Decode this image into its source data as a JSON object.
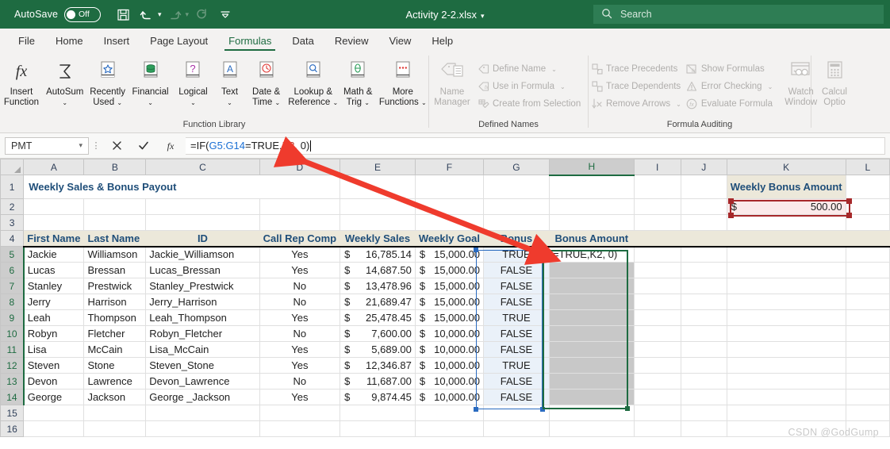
{
  "titlebar": {
    "autosave_label": "AutoSave",
    "autosave_state": "Off",
    "save_icon": "save-icon",
    "undo_icon": "undo-icon",
    "redo_icon": "redo-icon",
    "refresh_icon": "refresh-icon",
    "customize_icon": "customize-quick-access-icon",
    "document_title": "Activity 2-2.xlsx",
    "search_placeholder": "Search",
    "search_icon": "search-icon",
    "accent_color": "#1e6b41"
  },
  "tabs": [
    {
      "label": "File",
      "active": false
    },
    {
      "label": "Home",
      "active": false
    },
    {
      "label": "Insert",
      "active": false
    },
    {
      "label": "Page Layout",
      "active": false
    },
    {
      "label": "Formulas",
      "active": true
    },
    {
      "label": "Data",
      "active": false
    },
    {
      "label": "Review",
      "active": false
    },
    {
      "label": "View",
      "active": false
    },
    {
      "label": "Help",
      "active": false
    }
  ],
  "ribbon": {
    "groups": [
      {
        "title": "Function Library",
        "buttons": [
          {
            "label_line1": "Insert",
            "label_line2": "Function",
            "icon": "insert-function-icon",
            "caret": false
          },
          {
            "label_line1": "AutoSum",
            "label_line2": "",
            "icon": "autosum-icon",
            "caret": true
          },
          {
            "label_line1": "Recently",
            "label_line2": "Used",
            "icon": "recently-used-icon",
            "caret": true
          },
          {
            "label_line1": "Financial",
            "label_line2": "",
            "icon": "financial-icon",
            "caret": true
          },
          {
            "label_line1": "Logical",
            "label_line2": "",
            "icon": "logical-icon",
            "caret": true
          },
          {
            "label_line1": "Text",
            "label_line2": "",
            "icon": "text-icon",
            "caret": true
          },
          {
            "label_line1": "Date &",
            "label_line2": "Time",
            "icon": "date-time-icon",
            "caret": true
          },
          {
            "label_line1": "Lookup &",
            "label_line2": "Reference",
            "icon": "lookup-reference-icon",
            "caret": true
          },
          {
            "label_line1": "Math &",
            "label_line2": "Trig",
            "icon": "math-trig-icon",
            "caret": true
          },
          {
            "label_line1": "More",
            "label_line2": "Functions",
            "icon": "more-functions-icon",
            "caret": true
          }
        ]
      },
      {
        "title": "Defined Names",
        "big": {
          "label_line1": "Name",
          "label_line2": "Manager",
          "icon": "name-manager-icon"
        },
        "items": [
          {
            "label": "Define Name",
            "icon": "define-name-icon",
            "caret": true
          },
          {
            "label": "Use in Formula",
            "icon": "use-in-formula-icon",
            "caret": true
          },
          {
            "label": "Create from Selection",
            "icon": "create-from-selection-icon",
            "caret": false
          }
        ]
      },
      {
        "title": "Formula Auditing",
        "col1": [
          {
            "label": "Trace Precedents",
            "icon": "trace-precedents-icon",
            "caret": false
          },
          {
            "label": "Trace Dependents",
            "icon": "trace-dependents-icon",
            "caret": false
          },
          {
            "label": "Remove Arrows",
            "icon": "remove-arrows-icon",
            "caret": true
          }
        ],
        "col2": [
          {
            "label": "Show Formulas",
            "icon": "show-formulas-icon",
            "caret": false
          },
          {
            "label": "Error Checking",
            "icon": "error-checking-icon",
            "caret": true
          },
          {
            "label": "Evaluate Formula",
            "icon": "evaluate-formula-icon",
            "caret": false
          }
        ],
        "watch": {
          "label_line1": "Watch",
          "label_line2": "Window",
          "icon": "watch-window-icon"
        }
      },
      {
        "title": "",
        "calc": {
          "label_line1": "Calcul",
          "label_line2": "Optio",
          "icon": "calculation-options-icon"
        }
      }
    ]
  },
  "formula_bar": {
    "name_box_value": "PMT",
    "cancel_icon": "cancel-icon",
    "enter_icon": "confirm-icon",
    "insert_function_icon": "insert-function-icon",
    "formula_parts": [
      {
        "text": "=IF(",
        "color": "#000000"
      },
      {
        "text": "G5:G14",
        "color": "#1a6fd4"
      },
      {
        "text": "=TRUE,",
        "color": "#000000"
      },
      {
        "text": "K2",
        "color": "#c0392b"
      },
      {
        "text": ", 0)",
        "color": "#000000"
      }
    ],
    "formula_full": "=IF(G5:G14=TRUE,K2, 0)"
  },
  "sheet": {
    "column_headers": [
      "A",
      "B",
      "C",
      "D",
      "E",
      "F",
      "G",
      "H",
      "I",
      "J",
      "K",
      "L"
    ],
    "selected_column": "H",
    "row_numbers": [
      "1",
      "2",
      "3",
      "4",
      "5",
      "6",
      "7",
      "8",
      "9",
      "10",
      "11",
      "12",
      "13",
      "14",
      "15",
      "16"
    ],
    "selected_rows": [
      "5",
      "6",
      "7",
      "8",
      "9",
      "10",
      "11",
      "12",
      "13",
      "14"
    ],
    "title_cell": "Weekly Sales & Bonus Payout",
    "k_banner": "Weekly Bonus Amount",
    "k_value_symbol": "$",
    "k_value": "500.00",
    "headers": {
      "first_name": "First Name",
      "last_name": "Last Name",
      "id": "ID",
      "call_rep_comp": "Call Rep Comp",
      "weekly_sales": "Weekly Sales",
      "weekly_goal": "Weekly Goal",
      "bonus": "Bonus",
      "bonus_amount": "Bonus Amount"
    },
    "editing_cell_text": "=TRUE,K2, 0)",
    "rows": [
      {
        "first": "Jackie",
        "last": "Williamson",
        "id": "Jackie_Williamson",
        "comp": "Yes",
        "sales": "16,785.14",
        "goal": "15,000.00",
        "bonus": "TRUE"
      },
      {
        "first": "Lucas",
        "last": "Bressan",
        "id": "Lucas_Bressan",
        "comp": "Yes",
        "sales": "14,687.50",
        "goal": "15,000.00",
        "bonus": "FALSE"
      },
      {
        "first": "Stanley",
        "last": "Prestwick",
        "id": "Stanley_Prestwick",
        "comp": "No",
        "sales": "13,478.96",
        "goal": "15,000.00",
        "bonus": "FALSE"
      },
      {
        "first": "Jerry",
        "last": "Harrison",
        "id": "Jerry_Harrison",
        "comp": "No",
        "sales": "21,689.47",
        "goal": "15,000.00",
        "bonus": "FALSE"
      },
      {
        "first": "Leah",
        "last": "Thompson",
        "id": "Leah_Thompson",
        "comp": "Yes",
        "sales": "25,478.45",
        "goal": "15,000.00",
        "bonus": "TRUE"
      },
      {
        "first": "Robyn",
        "last": "Fletcher",
        "id": "Robyn_Fletcher",
        "comp": "No",
        "sales": "7,600.00",
        "goal": "10,000.00",
        "bonus": "FALSE"
      },
      {
        "first": "Lisa",
        "last": "McCain",
        "id": "Lisa_McCain",
        "comp": "Yes",
        "sales": "5,689.00",
        "goal": "10,000.00",
        "bonus": "FALSE"
      },
      {
        "first": "Steven",
        "last": "Stone",
        "id": "Steven_Stone",
        "comp": "Yes",
        "sales": "12,346.87",
        "goal": "10,000.00",
        "bonus": "TRUE"
      },
      {
        "first": "Devon",
        "last": "Lawrence",
        "id": "Devon_Lawrence",
        "comp": "No",
        "sales": "11,687.00",
        "goal": "10,000.00",
        "bonus": "FALSE"
      },
      {
        "first": "George",
        "last": "Jackson",
        "id": "George _Jackson",
        "comp": "Yes",
        "sales": "9,874.45",
        "goal": "10,000.00",
        "bonus": "FALSE"
      }
    ],
    "currency_symbol": "$"
  },
  "annotation": {
    "arrow_color": "#ef3b2d",
    "arrow_name": "red-double-arrow-annotation"
  },
  "watermark": "CSDN @GodGump"
}
